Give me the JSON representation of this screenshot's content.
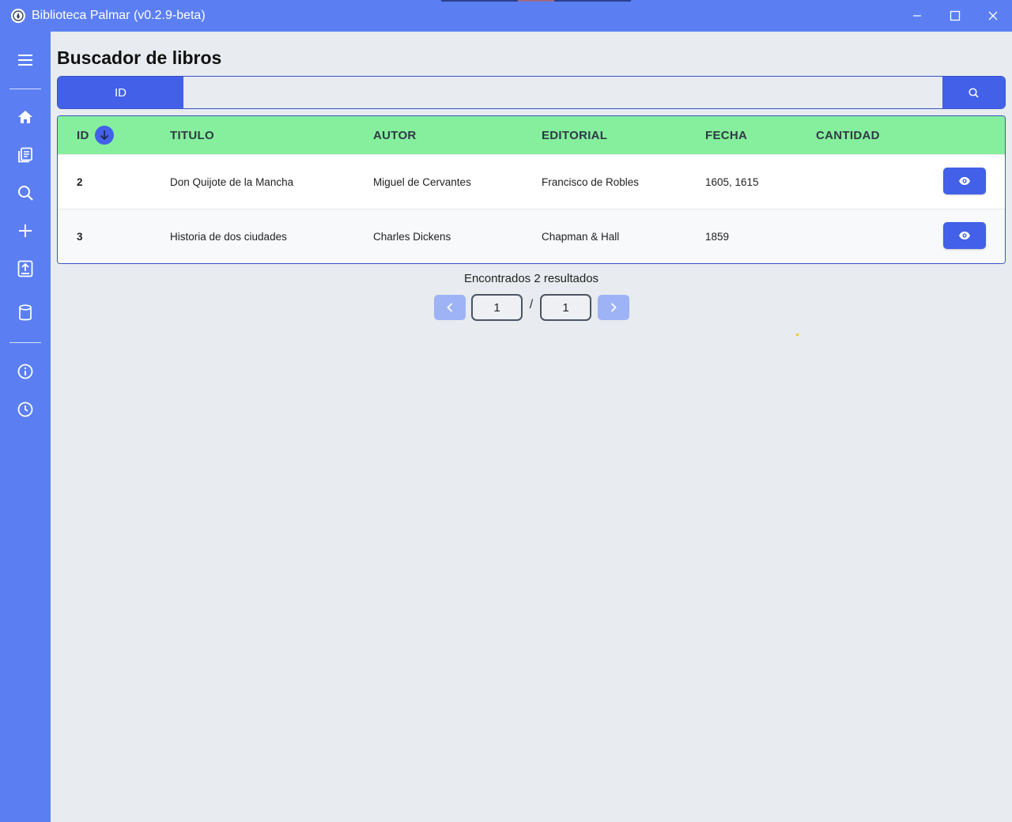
{
  "window": {
    "title": "Biblioteca Palmar (v0.2.9-beta)",
    "controls": [
      "minimize-icon",
      "maximize-icon",
      "close-icon"
    ]
  },
  "sidebar": {
    "items": [
      {
        "name": "menu",
        "icon": "hamburger-icon"
      },
      {
        "name": "home",
        "icon": "home-icon"
      },
      {
        "name": "books",
        "icon": "books-icon"
      },
      {
        "name": "search",
        "icon": "search-icon"
      },
      {
        "name": "add",
        "icon": "plus-icon"
      },
      {
        "name": "upload",
        "icon": "upload-icon"
      },
      {
        "name": "database",
        "icon": "database-icon"
      },
      {
        "name": "info",
        "icon": "info-icon"
      },
      {
        "name": "history",
        "icon": "clock-icon"
      }
    ]
  },
  "page": {
    "title": "Buscador de libros"
  },
  "search": {
    "field": "ID",
    "value": "",
    "placeholder": ""
  },
  "table": {
    "headers": [
      "ID",
      "TITULO",
      "AUTOR",
      "EDITORIAL",
      "FECHA",
      "CANTIDAD"
    ],
    "rows": [
      {
        "id": "2",
        "titulo": "Don Quijote de la Mancha",
        "autor": "Miguel de Cervantes",
        "editorial": "Francisco de Robles",
        "fecha": "1605, 1615",
        "cantidad": ""
      },
      {
        "id": "3",
        "titulo": "Historia de dos ciudades",
        "autor": "Charles Dickens",
        "editorial": "Chapman & Hall",
        "fecha": "1859",
        "cantidad": ""
      }
    ]
  },
  "results": {
    "text": "Encontrados 2 resultados"
  },
  "pagination": {
    "current": "1",
    "separator": "/",
    "total": "1"
  },
  "colors": {
    "accent": "#5b7ff3",
    "button": "#4260e8",
    "header": "#86ef9d",
    "background": "#e8ebef"
  }
}
